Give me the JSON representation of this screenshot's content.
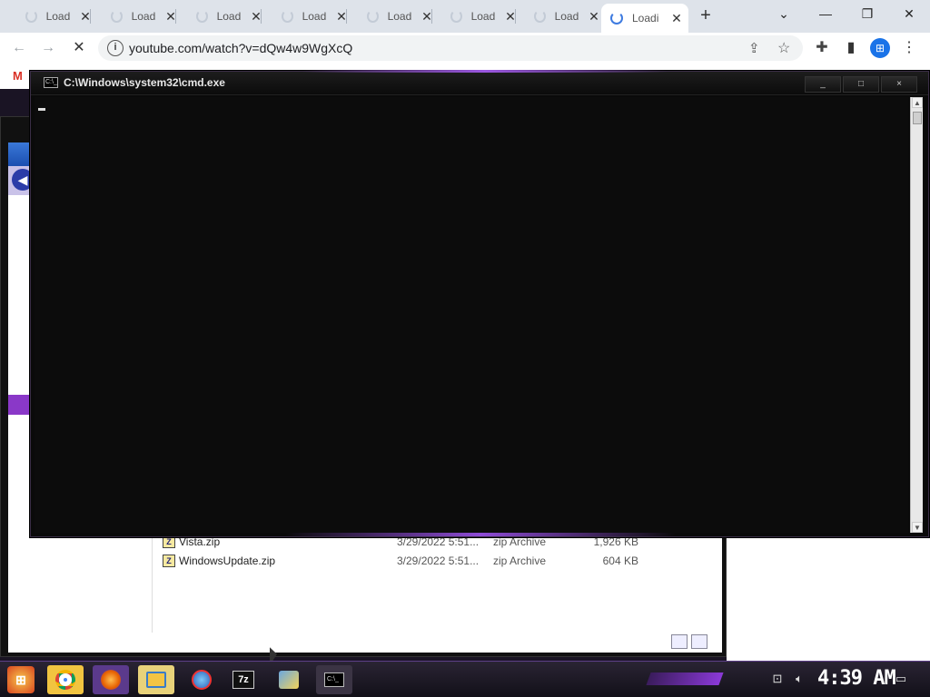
{
  "browser": {
    "tabs": [
      {
        "label": "Loadi"
      },
      {
        "label": "Loadi"
      },
      {
        "label": "Loadi"
      },
      {
        "label": "Loadi"
      },
      {
        "label": "Loadi"
      },
      {
        "label": "Loadi"
      },
      {
        "label": "Loadi"
      },
      {
        "label": "Loadi"
      }
    ],
    "new_tab": "+",
    "tab_search": "⌄",
    "window_controls": {
      "minimize": "—",
      "restore": "❐",
      "close": "✕"
    },
    "nav": {
      "back": "←",
      "forward": "→",
      "stop": "✕"
    },
    "url": "youtube.com/watch?v=dQw4w9WgXcQ",
    "info_icon": "i"
  },
  "cmd": {
    "title": "C:\\Windows\\system32\\cmd.exe",
    "controls": {
      "minimize": "_",
      "maximize": "□",
      "close": "×"
    },
    "icon_text": "C:\\_"
  },
  "explorer": {
    "files": [
      {
        "name": "Vista.zip",
        "date": "3/29/2022 5:51...",
        "type": "zip Archive",
        "size": "1,926 KB"
      },
      {
        "name": "WindowsUpdate.zip",
        "date": "3/29/2022 5:51...",
        "type": "zip Archive",
        "size": "604 KB"
      }
    ]
  },
  "taskbar": {
    "start_glyph": "⊞",
    "pinned": [
      "chrome-icon",
      "firefox-icon",
      "file-explorer-icon",
      "paint-icon",
      "7zip-icon",
      "network-icon",
      "cmd-icon"
    ],
    "seven_zip_label": "7z",
    "clock": "4:39 AM"
  },
  "colors": {
    "accent_purple": "#8b39d8",
    "chrome_tab_strip": "#dee3ea",
    "cmd_background": "#0c0c0c",
    "taskbar_active": "#f1c440"
  }
}
